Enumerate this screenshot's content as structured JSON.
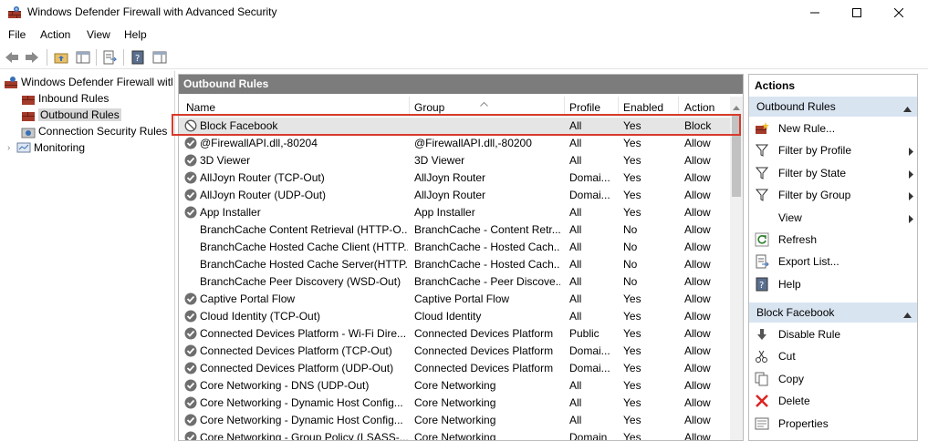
{
  "window": {
    "title": "Windows Defender Firewall with Advanced Security"
  },
  "menu": [
    "File",
    "Action",
    "View",
    "Help"
  ],
  "tree": {
    "root": "Windows Defender Firewall witl",
    "items": [
      "Inbound Rules",
      "Outbound Rules",
      "Connection Security Rules",
      "Monitoring"
    ]
  },
  "middle": {
    "header": "Outbound Rules",
    "columns": [
      "Name",
      "Group",
      "Profile",
      "Enabled",
      "Action"
    ],
    "rows": [
      {
        "name": "Block Facebook",
        "group": "",
        "profile": "All",
        "enabled": "Yes",
        "action": "Block",
        "icon": "block-icon"
      },
      {
        "name": "@FirewallAPI.dll,-80204",
        "group": "@FirewallAPI.dll,-80200",
        "profile": "All",
        "enabled": "Yes",
        "action": "Allow",
        "icon": "allow-check-icon"
      },
      {
        "name": "3D Viewer",
        "group": "3D Viewer",
        "profile": "All",
        "enabled": "Yes",
        "action": "Allow",
        "icon": "allow-check-icon"
      },
      {
        "name": "AllJoyn Router (TCP-Out)",
        "group": "AllJoyn Router",
        "profile": "Domai...",
        "enabled": "Yes",
        "action": "Allow",
        "icon": "allow-check-icon"
      },
      {
        "name": "AllJoyn Router (UDP-Out)",
        "group": "AllJoyn Router",
        "profile": "Domai...",
        "enabled": "Yes",
        "action": "Allow",
        "icon": "allow-check-icon"
      },
      {
        "name": "App Installer",
        "group": "App Installer",
        "profile": "All",
        "enabled": "Yes",
        "action": "Allow",
        "icon": "allow-check-icon"
      },
      {
        "name": "BranchCache Content Retrieval (HTTP-O...",
        "group": "BranchCache - Content Retr...",
        "profile": "All",
        "enabled": "No",
        "action": "Allow",
        "icon": ""
      },
      {
        "name": "BranchCache Hosted Cache Client (HTTP...",
        "group": "BranchCache - Hosted Cach...",
        "profile": "All",
        "enabled": "No",
        "action": "Allow",
        "icon": ""
      },
      {
        "name": "BranchCache Hosted Cache Server(HTTP...",
        "group": "BranchCache - Hosted Cach...",
        "profile": "All",
        "enabled": "No",
        "action": "Allow",
        "icon": ""
      },
      {
        "name": "BranchCache Peer Discovery (WSD-Out)",
        "group": "BranchCache - Peer Discove...",
        "profile": "All",
        "enabled": "No",
        "action": "Allow",
        "icon": ""
      },
      {
        "name": "Captive Portal Flow",
        "group": "Captive Portal Flow",
        "profile": "All",
        "enabled": "Yes",
        "action": "Allow",
        "icon": "allow-check-icon"
      },
      {
        "name": "Cloud Identity (TCP-Out)",
        "group": "Cloud Identity",
        "profile": "All",
        "enabled": "Yes",
        "action": "Allow",
        "icon": "allow-check-icon"
      },
      {
        "name": "Connected Devices Platform - Wi-Fi Dire...",
        "group": "Connected Devices Platform",
        "profile": "Public",
        "enabled": "Yes",
        "action": "Allow",
        "icon": "allow-check-icon"
      },
      {
        "name": "Connected Devices Platform (TCP-Out)",
        "group": "Connected Devices Platform",
        "profile": "Domai...",
        "enabled": "Yes",
        "action": "Allow",
        "icon": "allow-check-icon"
      },
      {
        "name": "Connected Devices Platform (UDP-Out)",
        "group": "Connected Devices Platform",
        "profile": "Domai...",
        "enabled": "Yes",
        "action": "Allow",
        "icon": "allow-check-icon"
      },
      {
        "name": "Core Networking - DNS (UDP-Out)",
        "group": "Core Networking",
        "profile": "All",
        "enabled": "Yes",
        "action": "Allow",
        "icon": "allow-check-icon"
      },
      {
        "name": "Core Networking - Dynamic Host Config...",
        "group": "Core Networking",
        "profile": "All",
        "enabled": "Yes",
        "action": "Allow",
        "icon": "allow-check-icon"
      },
      {
        "name": "Core Networking - Dynamic Host Config...",
        "group": "Core Networking",
        "profile": "All",
        "enabled": "Yes",
        "action": "Allow",
        "icon": "allow-check-icon"
      },
      {
        "name": "Core Networking - Group Policy (LSASS-...",
        "group": "Core Networking",
        "profile": "Domain",
        "enabled": "Yes",
        "action": "Allow",
        "icon": "allow-check-icon"
      }
    ]
  },
  "actions": {
    "title": "Actions",
    "section1": {
      "label": "Outbound Rules",
      "items": [
        {
          "label": "New Rule...",
          "icon": "new-rule-icon",
          "submenu": false
        },
        {
          "label": "Filter by Profile",
          "icon": "filter-icon",
          "submenu": true
        },
        {
          "label": "Filter by State",
          "icon": "filter-icon",
          "submenu": true
        },
        {
          "label": "Filter by Group",
          "icon": "filter-icon",
          "submenu": true
        },
        {
          "label": "View",
          "icon": "",
          "submenu": true
        },
        {
          "label": "Refresh",
          "icon": "refresh-icon",
          "submenu": false
        },
        {
          "label": "Export List...",
          "icon": "export-icon",
          "submenu": false
        },
        {
          "label": "Help",
          "icon": "help-icon",
          "submenu": false
        }
      ]
    },
    "section2": {
      "label": "Block Facebook",
      "items": [
        {
          "label": "Disable Rule",
          "icon": "disable-icon"
        },
        {
          "label": "Cut",
          "icon": "cut-icon"
        },
        {
          "label": "Copy",
          "icon": "copy-icon"
        },
        {
          "label": "Delete",
          "icon": "delete-icon"
        },
        {
          "label": "Properties",
          "icon": "properties-icon"
        }
      ]
    }
  },
  "colors": {
    "pane_header": "#7c7c7c",
    "section_header": "#d9e4f1",
    "highlight": "#d93a2b",
    "selected_row": "#e5e5e5"
  }
}
